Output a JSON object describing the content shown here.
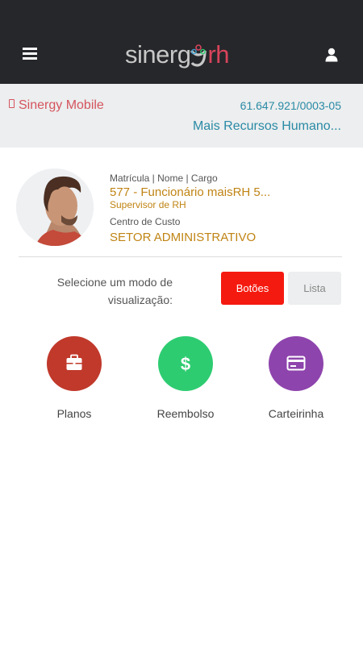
{
  "header": {
    "logo_text_a": "sinerg",
    "logo_text_b": "rh",
    "menu_icon": "hamburger-icon",
    "user_icon": "user-icon"
  },
  "info": {
    "app_name": "Sinergy Mobile",
    "cnpj": "61.647.921/0003-05",
    "company": "Mais Recursos Humano..."
  },
  "profile": {
    "id_label": "Matrícula | Nome | Cargo",
    "id_value": "577 - Funcionário maisRH 5...",
    "role": "Supervisor de RH",
    "cost_center_label": "Centro de Custo",
    "cost_center_value": "SETOR ADMINISTRATIVO"
  },
  "view_mode": {
    "label": "Selecione um modo de visualização:",
    "options": [
      "Botões",
      "Lista"
    ],
    "selected": "Botões"
  },
  "actions": [
    {
      "label": "Planos",
      "icon": "briefcase-icon",
      "color": "#c0392b"
    },
    {
      "label": "Reembolso",
      "icon": "dollar-icon",
      "color": "#2ecc71"
    },
    {
      "label": "Carteirinha",
      "icon": "card-icon",
      "color": "#8e44ad"
    }
  ],
  "colors": {
    "header_bg": "#26272b",
    "accent_red": "#f51a10",
    "gold": "#c08414",
    "teal": "#2a8aa5"
  }
}
